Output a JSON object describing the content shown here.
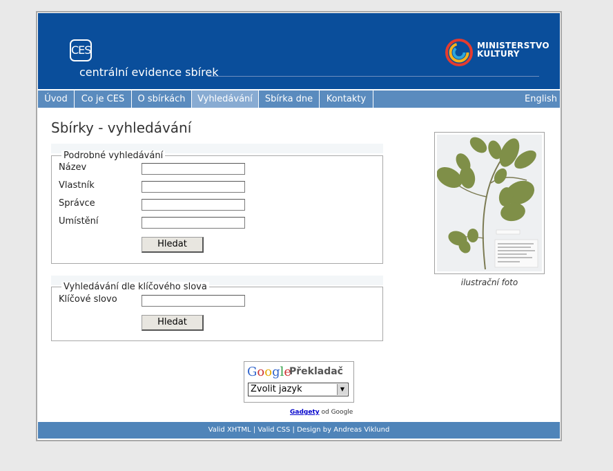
{
  "header": {
    "logo_text": "CES",
    "tagline": "centrální evidence sbírek",
    "ministry_line1": "MINISTERSTVO",
    "ministry_line2": "KULTURY"
  },
  "nav": {
    "items": [
      {
        "label": "Úvod"
      },
      {
        "label": "Co je CES"
      },
      {
        "label": "O sbírkách"
      },
      {
        "label": "Vyhledávání",
        "active": true
      },
      {
        "label": "Sbírka dne"
      },
      {
        "label": "Kontakty"
      }
    ],
    "english": "English"
  },
  "page": {
    "title": "Sbírky - vyhledávání"
  },
  "detailed_search": {
    "legend": "Podrobné vyhledávání",
    "fields": [
      {
        "label": "Název",
        "value": ""
      },
      {
        "label": "Vlastník",
        "value": ""
      },
      {
        "label": "Správce",
        "value": ""
      },
      {
        "label": "Umístění",
        "value": ""
      }
    ],
    "button": "Hledat"
  },
  "keyword_search": {
    "legend": "Vyhledávání dle klíčového slova",
    "field_label": "Klíčové slovo",
    "field_value": "",
    "button": "Hledat"
  },
  "photo": {
    "caption": "ilustrační foto"
  },
  "translate": {
    "brand": "Google",
    "title": "Překladač",
    "select_value": "Zvolit jazyk",
    "credit_link": "Gadgety",
    "credit_rest": "od Google"
  },
  "footer": {
    "valid_xhtml": "Valid XHTML",
    "valid_css": "Valid CSS",
    "design": "Design by Andreas Viklund",
    "separator": "|"
  },
  "colors": {
    "banner": "#0a4e9b",
    "nav": "#5a8bbe",
    "nav_active": "#88abd2",
    "footer": "#4f84b9"
  }
}
